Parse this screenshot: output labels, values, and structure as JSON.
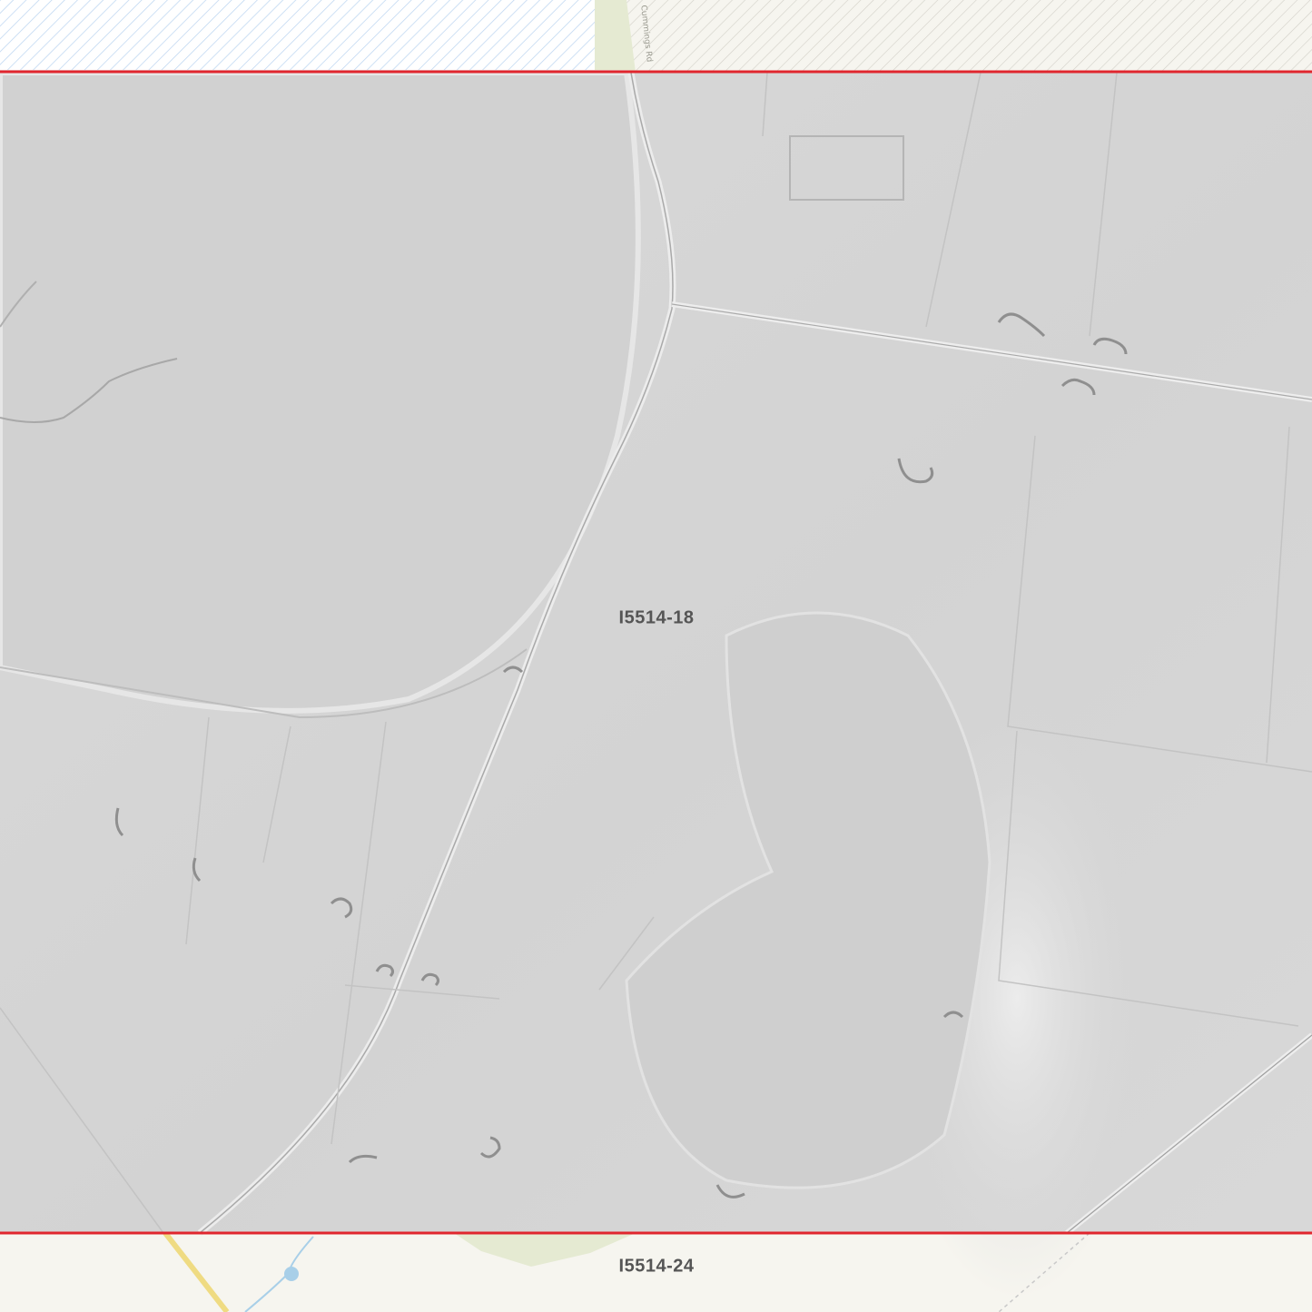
{
  "map": {
    "road_label": "Cummings Rd",
    "tiles": [
      {
        "id": "I5514-18",
        "label": "I5514-18",
        "status": "selected"
      },
      {
        "id": "I5514-24",
        "label": "I5514-24",
        "status": "adjacent"
      }
    ],
    "colors": {
      "basemap": "#f6f5ef",
      "water_hatch": "#9ec4ea",
      "park": "#e5ead2",
      "hillshade": "#d4d4d4",
      "tile_border": "#e0262e",
      "road_yellow": "#efdb82",
      "waterbody": "#a8cfe8"
    }
  }
}
